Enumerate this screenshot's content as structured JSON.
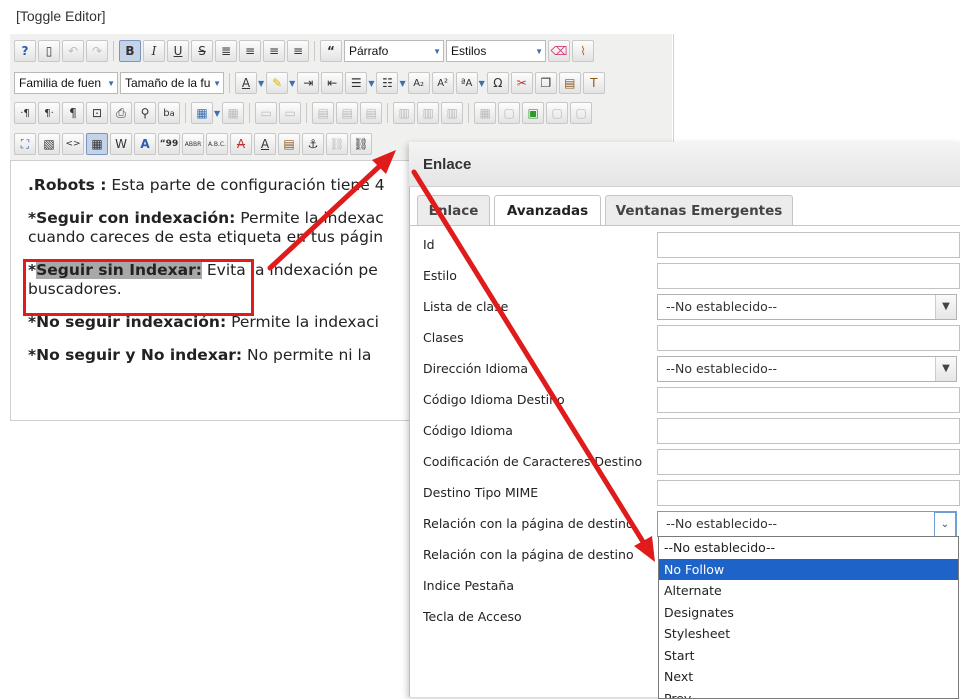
{
  "toggle_editor": "[Toggle Editor]",
  "toolbar": {
    "format_select": "Párrafo",
    "styles_select": "Estilos",
    "font_family_select": "Familia de fuen",
    "font_size_select": "Tamaño de la fu"
  },
  "content": {
    "p1_bold": ".Robots :",
    "p1_text": " Esta parte de configuración tiene 4",
    "p2_bold": "*Seguir con indexación:",
    "p2_text": " Permite la indexac",
    "p2_text2": "cuando careces de esta etiqueta en tus págin",
    "p3_star": "*",
    "p3_highlight": "Seguir sin Indexar:",
    "p3_text": " Evita la indexación pe",
    "p3_text2": "buscadores.",
    "p4_bold": "*No seguir indexación:",
    "p4_text": " Permite la indexaci",
    "p5_bold": "*No seguir y No indexar:",
    "p5_text": " No permite ni la"
  },
  "dialog": {
    "title": "Enlace",
    "tabs": [
      "Enlace",
      "Avanzadas",
      "Ventanas Emergentes"
    ],
    "fields": {
      "id": "Id",
      "style": "Estilo",
      "class_list": "Lista de clase",
      "classes": "Clases",
      "lang_dir": "Dirección Idioma",
      "target_lang_code": "Código Idioma Destino",
      "lang_code": "Código Idioma",
      "target_charset": "Codificación de Caracteres Destino",
      "target_mime": "Destino Tipo MIME",
      "rel": "Relación con la página de destino",
      "rev": "Relación con la página de destino",
      "tab_index": "Indice Pestaña",
      "access_key": "Tecla de Acceso"
    },
    "select_values": {
      "class_list": "--No establecido--",
      "lang_dir": "--No establecido--",
      "rel": "--No establecido--"
    },
    "dropdown_options": [
      "--No establecido--",
      "No Follow",
      "Alternate",
      "Designates",
      "Stylesheet",
      "Start",
      "Next",
      "Prev"
    ],
    "dropdown_selected": "No Follow"
  },
  "colors": {
    "annotation_red": "#e01b1b",
    "selection_blue": "#1e64c8"
  }
}
